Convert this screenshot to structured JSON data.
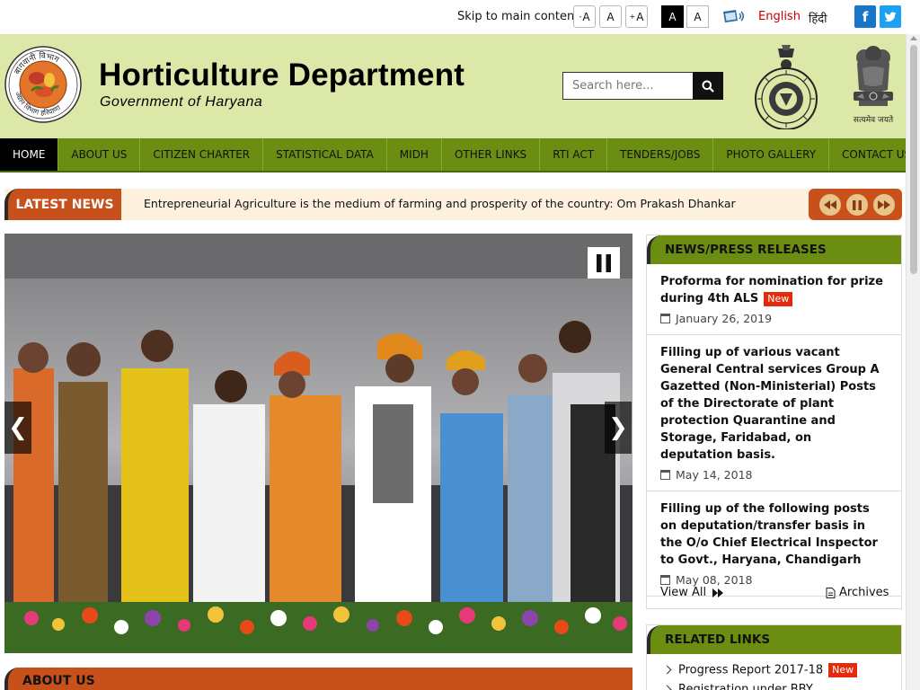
{
  "topbar": {
    "skip_label": "Skip to main content",
    "font_decrease": "A",
    "font_normal": "A",
    "font_increase": "A",
    "font_decrease_sign": "-",
    "font_increase_sign": "+",
    "theme_dark": "A",
    "theme_light": "A",
    "lang_english": "English",
    "lang_hindi": "हिंदी",
    "facebook": "f",
    "twitter": "t"
  },
  "header": {
    "title": "Horticulture Department",
    "subtitle": "Government of Haryana",
    "search_placeholder": "Search here...",
    "emblem_motto": "सत्यमेव जयते",
    "logo_arc_top": "बागवानी विभाग",
    "logo_arc_bottom": "उद्यान विभाग हरियाणा"
  },
  "nav": {
    "items": [
      {
        "label": "HOME"
      },
      {
        "label": "ABOUT US"
      },
      {
        "label": "CITIZEN CHARTER"
      },
      {
        "label": "STATISTICAL DATA"
      },
      {
        "label": "MIDH"
      },
      {
        "label": "OTHER LINKS"
      },
      {
        "label": "RTI ACT"
      },
      {
        "label": "TENDERS/JOBS"
      },
      {
        "label": "PHOTO GALLERY"
      },
      {
        "label": "CONTACT US"
      }
    ]
  },
  "latest_news": {
    "label": "LATEST NEWS",
    "text": "Entrepreneurial Agriculture is the medium of farming and prosperity of the country: Om Prakash Dhankar"
  },
  "slider": {
    "prev_symbol": "❮",
    "next_symbol": "❯"
  },
  "about": {
    "title": "ABOUT US"
  },
  "press": {
    "title": "NEWS/PRESS RELEASES",
    "new_badge": "New",
    "items": [
      {
        "title": "Proforma for nomination for prize during 4th ALS",
        "date": "January 26, 2019"
      },
      {
        "title": "Filling up of various vacant General Central services Group A Gazetted (Non-Ministerial) Posts of the Directorate of plant protection Quarantine and Storage, Faridabad, on deputation basis.",
        "date": "May 14, 2018"
      },
      {
        "title": "Filling up of the following posts on deputation/transfer basis in the O/o Chief Electrical Inspector to Govt., Haryana, Chandigarh",
        "date": "May 08, 2018"
      }
    ],
    "view_all": "View All",
    "archives": "Archives"
  },
  "related": {
    "title": "RELATED LINKS",
    "new_badge": "New",
    "items": [
      {
        "label": "Progress Report 2017-18"
      },
      {
        "label": "Registration under BBY"
      }
    ]
  },
  "colors": {
    "header_bg": "#dbe8a7",
    "nav_bg": "#6b8e12",
    "accent_orange": "#c8511b",
    "news_bg": "#fdf1de",
    "new_badge": "#e32b0b"
  }
}
